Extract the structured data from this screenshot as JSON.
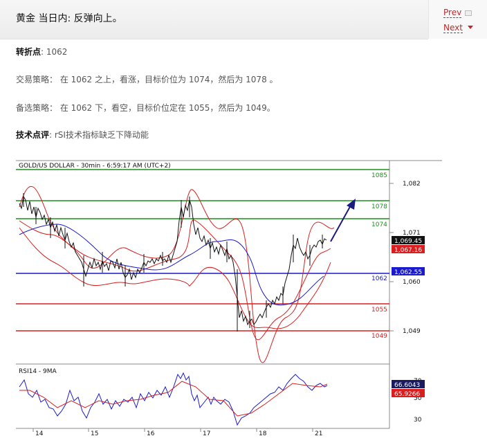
{
  "page": {
    "title": "黄金 当日内: 反弹向上。",
    "prev": "Prev",
    "next": "Next"
  },
  "content": {
    "pivot_label": "转折点",
    "pivot_value": ": 1062",
    "strategy_label": "交易策略",
    "strategy_text": "： 在 1062 之上，看涨，目标价位为 1074，然后为 1078 。",
    "alt_label": "备选策略",
    "alt_text": "： 在 1062 下，看空，目标价位定在 1055，然后为 1049。",
    "comment_label": "技术点评",
    "comment_text": ": rSI技术指标缺乏下降动能"
  },
  "chart": {
    "header": "GOLD/US DOLLAR - 30min - 6:59:17 AM (UTC+2)",
    "rsi_header": "RSI14 - 9MA",
    "price_ticks": [
      "1,082",
      "1,071",
      "1,060",
      "1,049"
    ],
    "rsi_ticks": [
      "70",
      "50",
      "30"
    ],
    "date_ticks": [
      "14",
      "15",
      "16",
      "17",
      "18",
      "21"
    ],
    "level_labels": {
      "r1085": "1085",
      "r1078": "1078",
      "r1074": "1074",
      "pivot": "1062",
      "s1055": "1055",
      "s1049": "1049"
    },
    "price_tags": {
      "last": "1,069.45",
      "prev": "1,067.16",
      "pivot": "1,062.55"
    },
    "rsi_tags": {
      "rsi": "66.6043",
      "ma": "65.9266"
    },
    "colors": {
      "green": "#1a8f1a",
      "blue": "#1a1acd",
      "red": "#d81e1e",
      "arrow": "#1a1a80"
    }
  },
  "chart_data": {
    "type": "line",
    "title": "GOLD/US DOLLAR - 30min - 6:59:17 AM (UTC+2)",
    "x": [
      "14",
      "15",
      "16",
      "17",
      "18",
      "21"
    ],
    "ylim": [
      1044,
      1087
    ],
    "resistance": [
      1085,
      1078,
      1074
    ],
    "pivot": 1062,
    "support": [
      1055,
      1049
    ],
    "last_price": 1069.45,
    "series": [
      {
        "name": "price",
        "values": [
          1072.5,
          1077,
          1073,
          1068,
          1063,
          1066,
          1064,
          1061,
          1064,
          1066,
          1077,
          1072,
          1068,
          1067,
          1052,
          1050,
          1053,
          1056,
          1064,
          1068,
          1066,
          1069.45
        ]
      },
      {
        "name": "RSI14",
        "values": [
          58,
          62,
          48,
          40,
          32,
          50,
          45,
          38,
          52,
          55,
          68,
          60,
          48,
          45,
          28,
          32,
          40,
          46,
          58,
          66,
          62,
          66.6
        ]
      }
    ]
  }
}
